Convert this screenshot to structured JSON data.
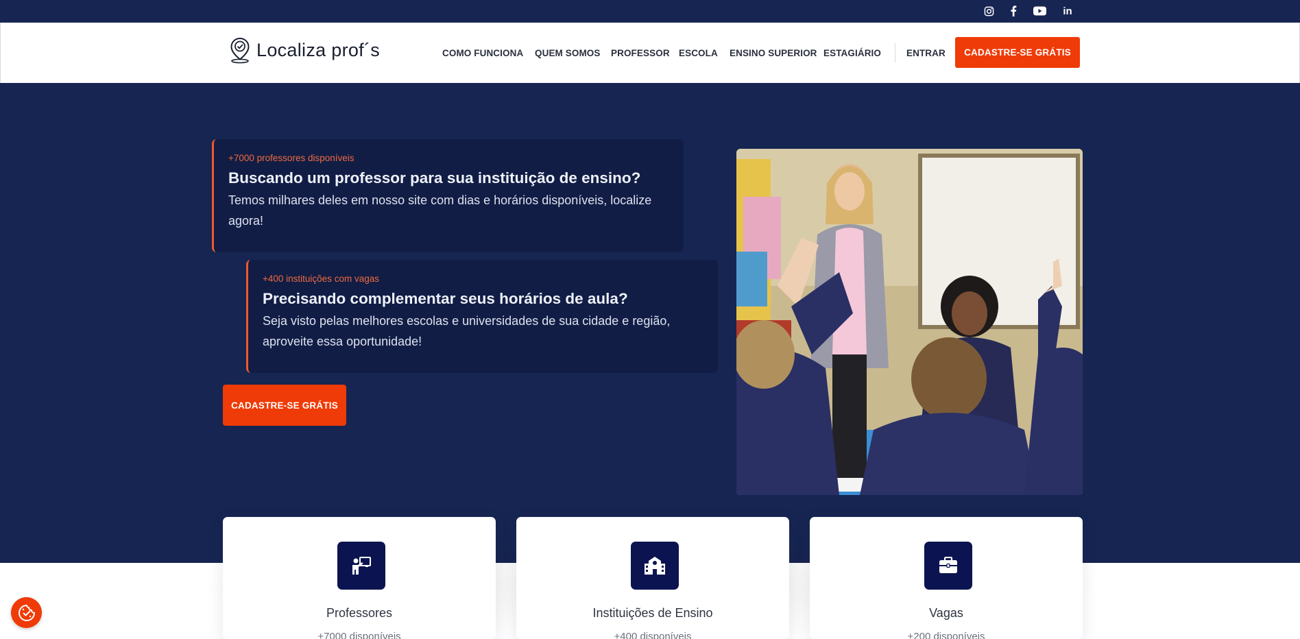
{
  "topbar": {
    "social": [
      {
        "icon": "instagram-icon"
      },
      {
        "icon": "facebook-icon"
      },
      {
        "icon": "youtube-icon"
      },
      {
        "icon": "linkedin-icon",
        "text": "in"
      }
    ]
  },
  "header": {
    "logo_text": "Localiza prof´s",
    "nav": [
      "COMO FUNCIONA",
      "QUEM SOMOS",
      "PROFESSOR",
      "ESCOLA",
      "ENSINO SUPERIOR",
      "ESTAGIÁRIO"
    ],
    "login": "ENTRAR",
    "cta": "CADASTRE-SE GRÁTIS"
  },
  "hero": {
    "card1": {
      "tag": "+7000 professores disponíveis",
      "title": "Buscando um professor para sua instituição de ensino?",
      "body": "Temos milhares deles em nosso site com dias e horários disponíveis, localize agora!"
    },
    "card2": {
      "tag": "+400 instituições com vagas",
      "title": "Precisando complementar seus horários de aula?",
      "body": "Seja visto pelas melhores escolas e universidades de sua cidade e região, aproveite essa oportunidade!"
    },
    "cta": "CADASTRE-SE GRÁTIS"
  },
  "features": [
    {
      "icon": "teacher-board-icon",
      "title": "Professores",
      "subtitle": "+7000 disponíveis"
    },
    {
      "icon": "school-building-icon",
      "title": "Instituições de Ensino",
      "subtitle": "+400 disponíveis"
    },
    {
      "icon": "briefcase-icon",
      "title": "Vagas",
      "subtitle": "+200 disponíveis"
    }
  ],
  "colors": {
    "navy": "#172552",
    "card_navy": "#111d45",
    "accent": "#ef3b07",
    "icon_bg": "#0b1450"
  },
  "cookie_widget": {
    "icon": "cookie-consent-icon"
  }
}
